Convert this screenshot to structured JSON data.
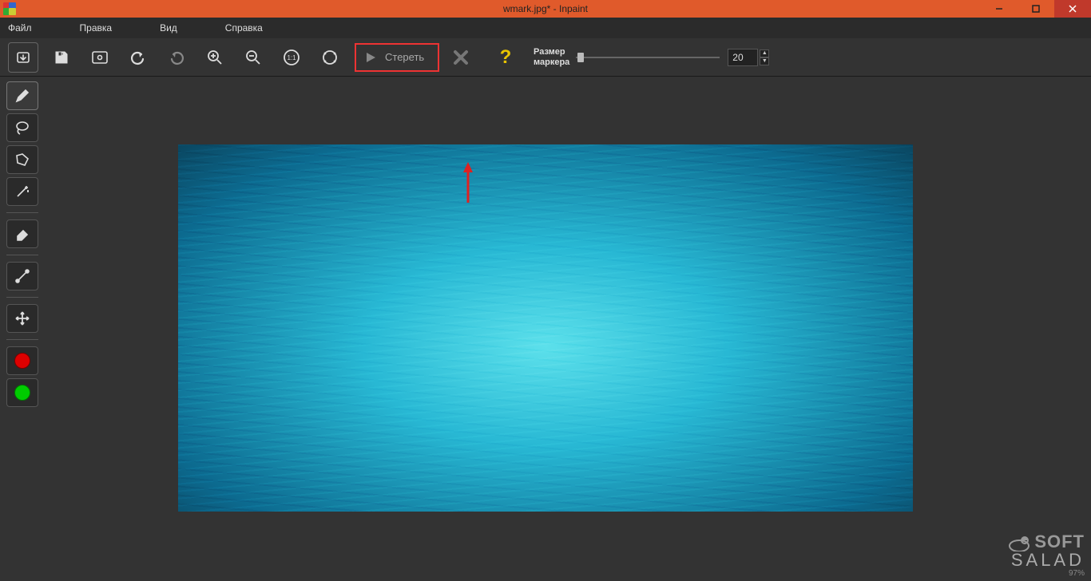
{
  "window": {
    "title": "wmark.jpg* - Inpaint"
  },
  "menubar": {
    "file": "Файл",
    "edit": "Правка",
    "view": "Вид",
    "help": "Справка"
  },
  "toolbar": {
    "erase_label": "Стереть",
    "marker_size_label": "Размер\nмаркера",
    "marker_size_value": "20"
  },
  "watermark": {
    "line1": "SOFT",
    "line2": "SALAD",
    "percent": "97%"
  },
  "icons": {
    "open": "open-icon",
    "save": "save-icon",
    "repeat": "repeat-icon",
    "undo": "undo-icon",
    "redo": "redo-icon",
    "zoom_in": "zoom-in-icon",
    "zoom_out": "zoom-out-icon",
    "zoom_1to1": "zoom-1to1-icon",
    "zoom_fit": "zoom-fit-icon",
    "cancel": "cancel-icon",
    "help": "help-icon",
    "marker": "marker-tool-icon",
    "lasso": "lasso-tool-icon",
    "polygon": "polygon-tool-icon",
    "magic": "magic-wand-tool-icon",
    "eraser": "eraser-tool-icon",
    "line": "line-tool-icon",
    "move": "move-tool-icon",
    "red": "red-mask-icon",
    "green": "green-mask-icon"
  }
}
